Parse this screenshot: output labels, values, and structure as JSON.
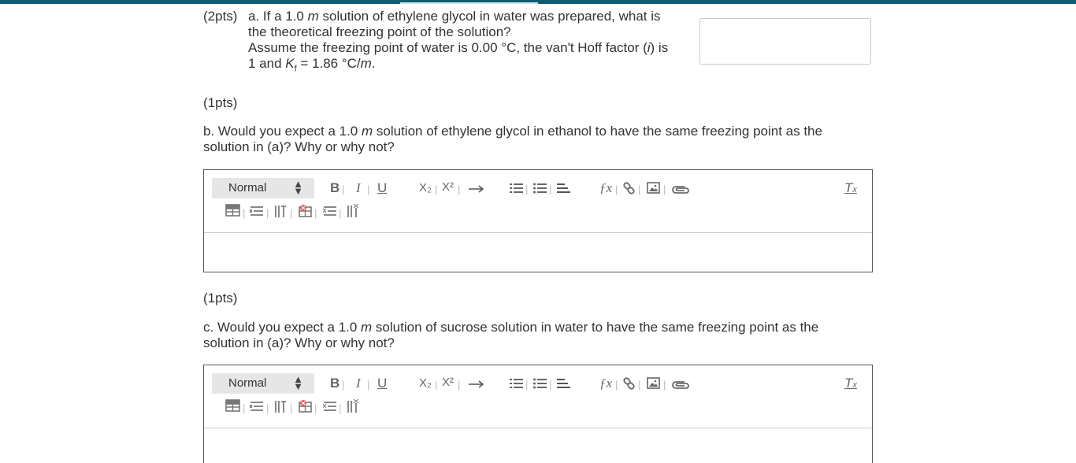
{
  "question_a": {
    "points": "(2pts)",
    "line1": "a. If a 1.0 ",
    "unit_m": "m",
    "line1_rest": " solution of ethylene glycol in water was prepared, what is",
    "line2": "the theoretical freezing point of the solution?",
    "line3": "Assume the freezing point of water is 0.00 °C, the van't Hoff factor (",
    "symbol_i": "i",
    "line3_rest": ") is",
    "line4_start": "1 and ",
    "symbol_K": "K",
    "subscript_f": "f",
    "line4_rest": " = 1.86 °C/",
    "unit_m_end": "m",
    "line4_end": "."
  },
  "question_b": {
    "points": "(1pts)",
    "line1": "b. Would you expect a 1.0 ",
    "unit_m": "m",
    "line1_rest": " solution of ethylene glycol in ethanol to have the same freezing point as the",
    "line2": "solution in (a)? Why or why not?"
  },
  "question_c": {
    "points": "(1pts)",
    "line1": "c. Would you expect a 1.0 ",
    "unit_m": "m",
    "line1_rest": " solution of sucrose solution in water to have the same freezing point as the",
    "line2": "solution in (a)? Why or why not?"
  },
  "editor_toolbar": {
    "format_value": "Normal",
    "bold": "B",
    "italic": "I",
    "underline": "U",
    "subscript": "X₂",
    "superscript": "X²",
    "separator": "|",
    "icons": [
      "bold-icon",
      "italic-icon",
      "underline-icon",
      "subscript-icon",
      "superscript-icon",
      "arrow-right-icon",
      "numbered-list-icon",
      "bulleted-list-icon",
      "align-left-icon",
      "formula-icon",
      "link-icon",
      "image-icon",
      "attach-icon",
      "clear-format-icon",
      "table-icon",
      "table-row-icon",
      "table-column-icon",
      "table-delete-icon",
      "table-row-delete-icon",
      "table-column-delete-icon"
    ]
  },
  "colors": {
    "top_bar": "#0e5e70",
    "text": "#333333",
    "editor_border": "#555555",
    "toolbar_icon": "#666666"
  }
}
